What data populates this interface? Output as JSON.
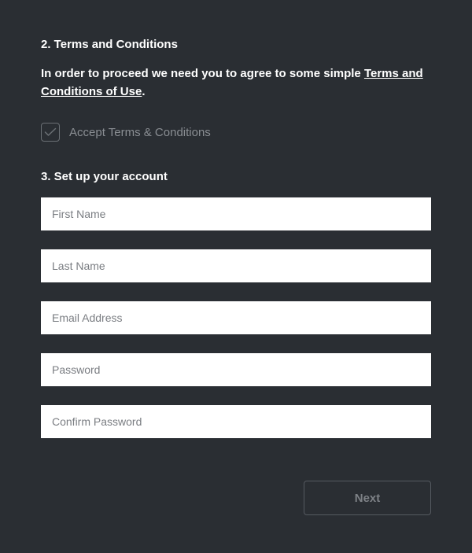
{
  "section2": {
    "heading": "2. Terms and Conditions",
    "intro_prefix": "In order to proceed we need you to agree to some simple ",
    "terms_link_text": "Terms and Conditions of Use",
    "intro_suffix": ".",
    "checkbox_label": "Accept Terms & Conditions"
  },
  "section3": {
    "heading": "3. Set up your account",
    "fields": {
      "first_name_placeholder": "First Name",
      "last_name_placeholder": "Last Name",
      "email_placeholder": "Email Address",
      "password_placeholder": "Password",
      "confirm_password_placeholder": "Confirm Password"
    }
  },
  "buttons": {
    "next_label": "Next"
  }
}
